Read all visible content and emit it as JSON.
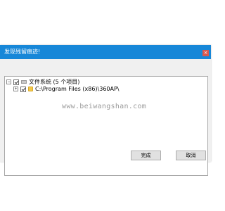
{
  "dialog": {
    "title": "发现残留痕迹!",
    "close_glyph": "×"
  },
  "tree": {
    "root": {
      "label": "文件系统 (5 个项目)",
      "expander": "−",
      "checked": true
    },
    "child": {
      "label": "C:\\Program Files (x86)\\360AP\\",
      "expander": "+",
      "checked": true
    }
  },
  "watermark": "www.beiwangshan.com",
  "buttons": {
    "ok_label": "完成",
    "cancel_label": "取消"
  },
  "colors": {
    "titlebar": "#1787d8",
    "close_button": "#d8584e",
    "dialog_background": "#f0f0f0"
  }
}
